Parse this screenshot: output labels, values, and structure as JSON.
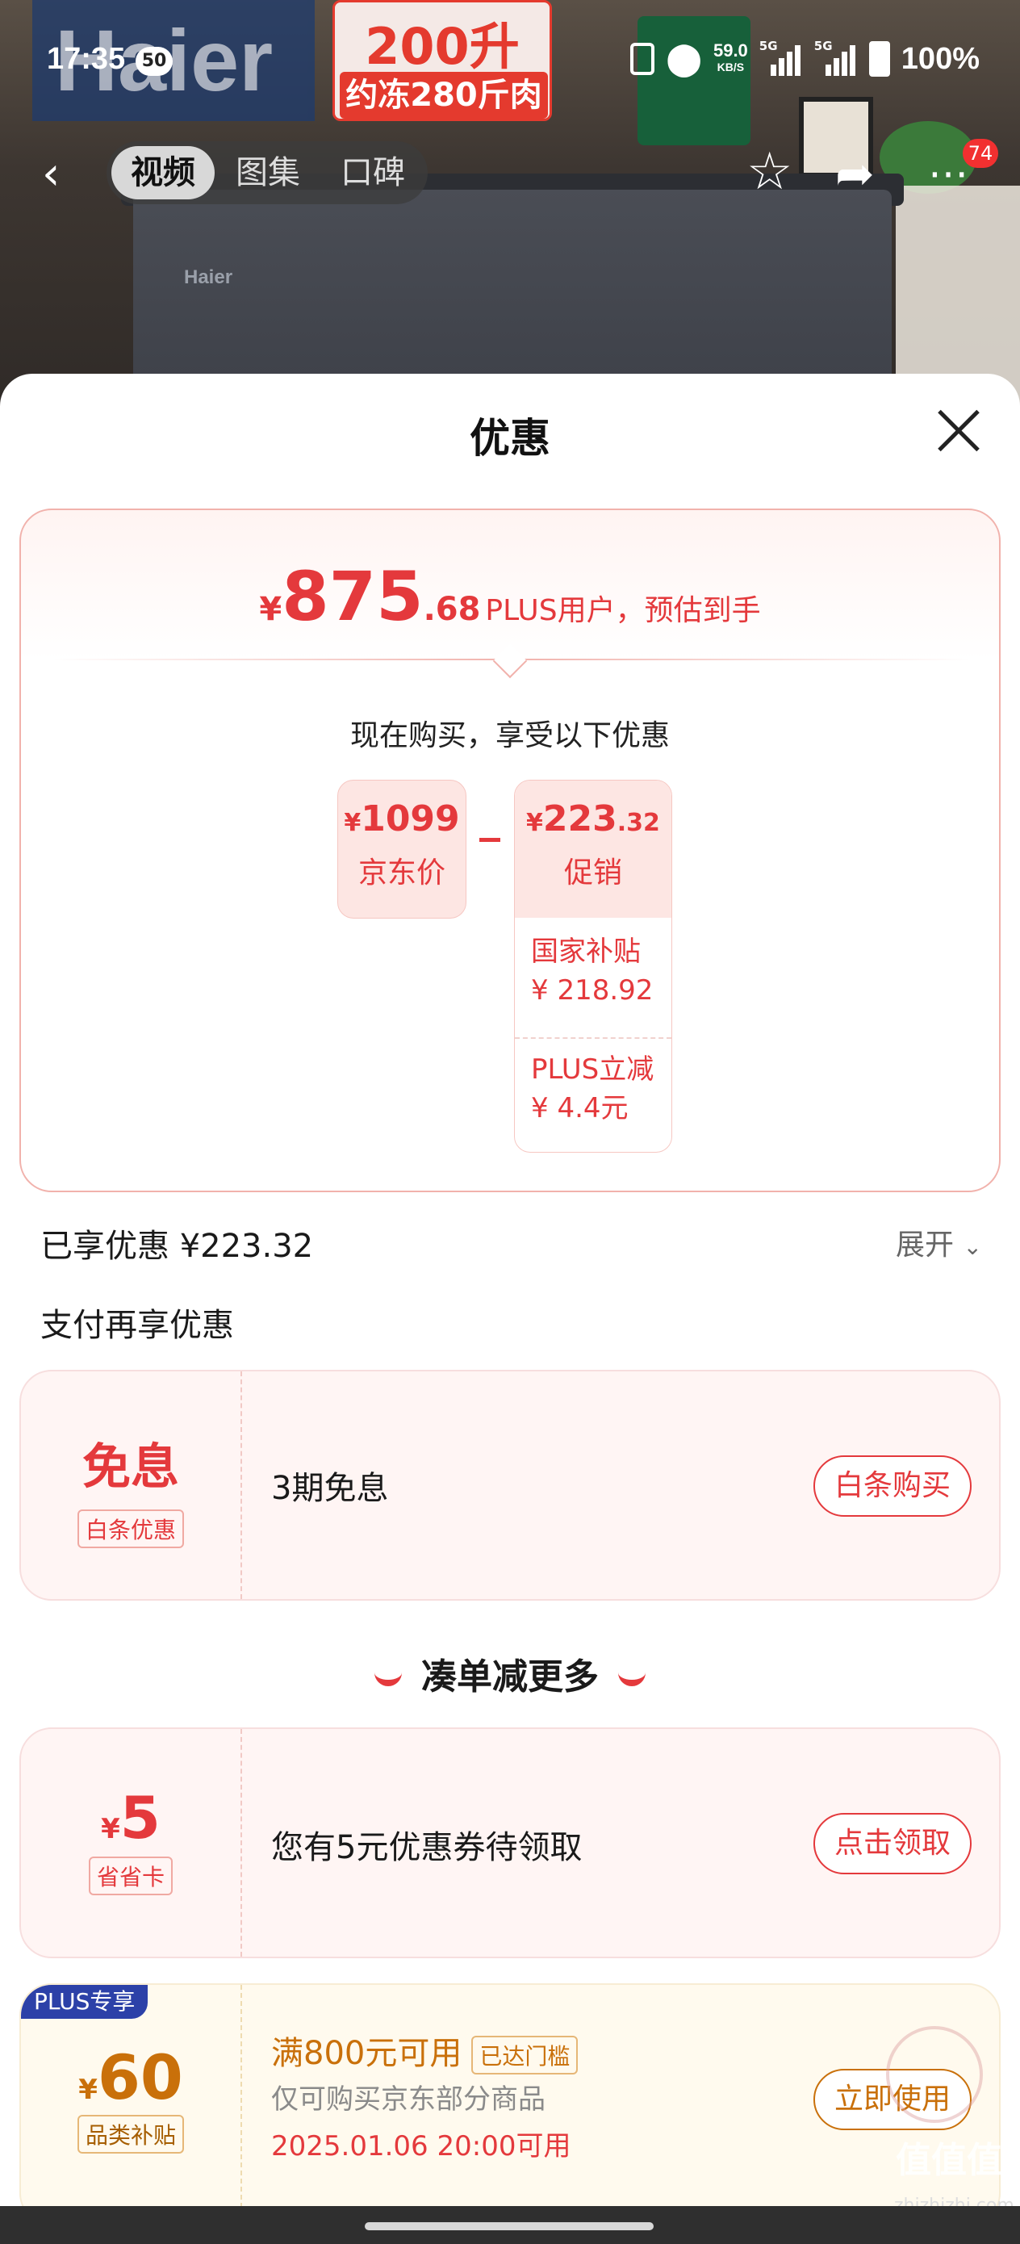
{
  "status_bar": {
    "time": "17:35",
    "notification_count": "50",
    "net_speed": "59.0",
    "net_unit": "KB/S",
    "signal1_label": "5G",
    "signal2_label": "5G",
    "battery": "100%"
  },
  "media_header": {
    "brand_logo": "Haier",
    "badge_line1": "200升",
    "badge_line2": "约冻280斤肉",
    "product_brand": "Haier",
    "tabs": [
      {
        "label": "视频",
        "active": true
      },
      {
        "label": "图集",
        "active": false
      },
      {
        "label": "口碑",
        "active": false
      }
    ],
    "cart_badge": "74"
  },
  "sheet": {
    "title": "优惠",
    "estimate": {
      "currency": "¥",
      "integer": "875",
      "decimal": ".68",
      "note": "PLUS用户，预估到手"
    },
    "buy_now_text": "现在购买，享受以下优惠",
    "jd_price": {
      "currency": "¥",
      "amount": "1099",
      "label": "京东价"
    },
    "promotion": {
      "currency": "¥",
      "amount": "223",
      "decimal": ".32",
      "label": "促销",
      "items": [
        {
          "name": "国家补贴",
          "value": "¥ 218.92"
        },
        {
          "name": "PLUS立减",
          "value": "¥ 4.4元"
        }
      ]
    },
    "enjoyed_text": "已享优惠 ¥223.32",
    "expand_label": "展开",
    "pay_section_title": "支付再享优惠",
    "baitiao": {
      "headline": "免息",
      "tag": "白条优惠",
      "desc": "3期免息",
      "action": "白条购买"
    },
    "more_section_title": "凑单减更多",
    "saver_card": {
      "currency": "¥",
      "amount": "5",
      "tag": "省省卡",
      "desc": "您有5元优惠券待领取",
      "action": "点击领取"
    },
    "plus_coupon": {
      "flag": "PLUS专享",
      "currency": "¥",
      "amount": "60",
      "tag": "品类补贴",
      "condition": "满800元可用",
      "threshold_tag": "已达门槛",
      "scope": "仅可购买京东部分商品",
      "time": "2025.01.06 20:00可用",
      "action": "立即使用"
    }
  },
  "watermark": {
    "site": "zhizhizhi.com",
    "logo": "值值值"
  },
  "colors": {
    "accent": "#e4393c",
    "gold": "#c9700a",
    "plus_blue": "#2c41a8"
  }
}
